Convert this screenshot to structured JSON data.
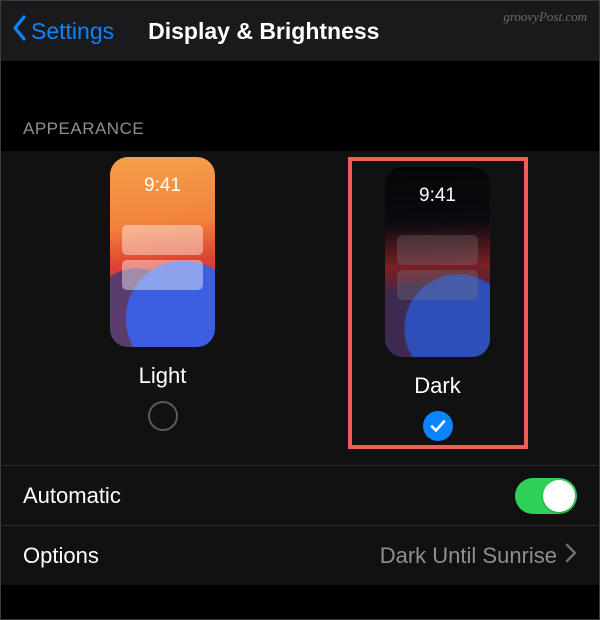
{
  "header": {
    "back_label": "Settings",
    "title": "Display & Brightness"
  },
  "watermark": "groovyPost.com",
  "appearance": {
    "section_label": "APPEARANCE",
    "preview_time": "9:41",
    "options": {
      "light": {
        "label": "Light",
        "selected": false
      },
      "dark": {
        "label": "Dark",
        "selected": true
      }
    }
  },
  "rows": {
    "automatic": {
      "label": "Automatic",
      "enabled": true
    },
    "options": {
      "label": "Options",
      "value": "Dark Until Sunrise"
    }
  }
}
